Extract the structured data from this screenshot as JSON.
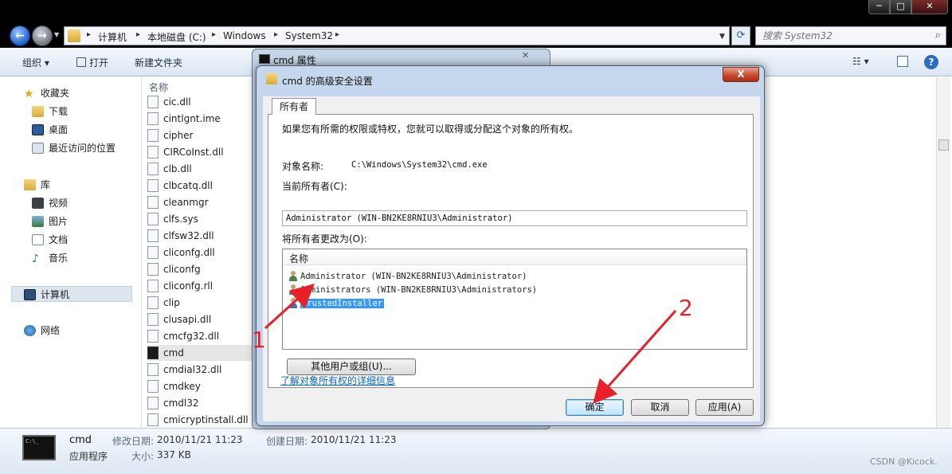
{
  "window": {
    "min_glyph": "─",
    "max_glyph": "□",
    "close_glyph": "✕"
  },
  "address": {
    "crumbs": [
      "计算机",
      "本地磁盘 (C:)",
      "Windows",
      "System32"
    ],
    "search_placeholder": "搜索 System32"
  },
  "toolbar": {
    "organize": "组织 ▾",
    "open": "打开",
    "new_folder": "新建文件夹"
  },
  "nav": {
    "favorites": "收藏夹",
    "downloads": "下载",
    "desktop": "桌面",
    "recent": "最近访问的位置",
    "libraries": "库",
    "videos": "视频",
    "pictures": "图片",
    "documents": "文档",
    "music": "音乐",
    "computer": "计算机",
    "network": "网络"
  },
  "filelist": {
    "header": "名称",
    "files": [
      "cic.dll",
      "cintlgnt.ime",
      "cipher",
      "CIRCoInst.dll",
      "clb.dll",
      "clbcatq.dll",
      "cleanmgr",
      "clfs.sys",
      "clfsw32.dll",
      "cliconfg.dll",
      "cliconfg",
      "cliconfg.rll",
      "clip",
      "clusapi.dll",
      "cmcfg32.dll",
      "cmd",
      "cmdial32.dll",
      "cmdkey",
      "cmdl32",
      "cmicryptinstall.dll"
    ],
    "selected": "cmd"
  },
  "details": {
    "name": "cmd",
    "type": "应用程序",
    "modified_label": "修改日期:",
    "modified_value": "2010/11/21 11:23",
    "size_label": "大小:",
    "size_value": "337 KB",
    "created_label": "创建日期:",
    "created_value": "2010/11/21 11:23"
  },
  "props_dialog": {
    "title": "cmd 属性"
  },
  "security_dialog": {
    "title": "cmd 的高级安全设置",
    "close": "X",
    "tab_owner": "所有者",
    "intro": "如果您有所需的权限或特权，您就可以取得或分配这个对象的所有权。",
    "object_name_label": "对象名称:",
    "object_name_value": "C:\\Windows\\System32\\cmd.exe",
    "current_owner_label": "当前所有者(C):",
    "current_owner_value": "Administrator (WIN-BN2KE8RNIU3\\Administrator)",
    "change_owner_label": "将所有者更改为(O):",
    "list_header": "名称",
    "owners": [
      "Administrator (WIN-BN2KE8RNIU3\\Administrator)",
      "Administrators (WIN-BN2KE8RNIU3\\Administrators)",
      "TrustedInstaller"
    ],
    "selected_owner": "TrustedInstaller",
    "other_users_button": "其他用户或组(U)...",
    "learn_link": "了解对象所有权的详细信息",
    "ok_button": "确定",
    "cancel_button": "取消",
    "apply_button": "应用(A)"
  },
  "annotations": {
    "label_1": "1",
    "label_2": "2",
    "color": "#e8202a"
  },
  "watermark": "CSDN @Kicock."
}
